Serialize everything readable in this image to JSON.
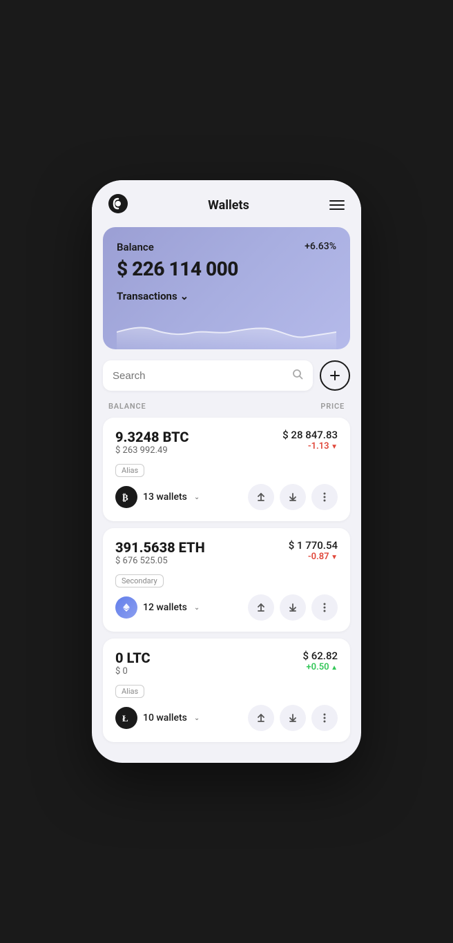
{
  "app": {
    "title": "Wallets"
  },
  "balance_card": {
    "label": "Balance",
    "amount": "$ 226 114 000",
    "change": "+6.63%",
    "transactions_label": "Transactions"
  },
  "search": {
    "placeholder": "Search"
  },
  "table_headers": {
    "balance": "BALANCE",
    "price": "PRICE"
  },
  "assets": [
    {
      "id": "btc",
      "amount": "9.3248 BTC",
      "usd_value": "$ 263 992.49",
      "price": "$ 28 847.83",
      "change": "-1.13",
      "change_type": "negative",
      "alias": "Alias",
      "wallets": "13 wallets",
      "icon": "₿"
    },
    {
      "id": "eth",
      "amount": "391.5638 ETH",
      "usd_value": "$ 676 525.05",
      "price": "$ 1 770.54",
      "change": "-0.87",
      "change_type": "negative",
      "alias": "Secondary",
      "wallets": "12 wallets",
      "icon": "Ξ"
    },
    {
      "id": "ltc",
      "amount": "0 LTC",
      "usd_value": "$ 0",
      "price": "$ 62.82",
      "change": "+0.50",
      "change_type": "positive",
      "alias": "Alias",
      "wallets": "10 wallets",
      "icon": "Ł"
    }
  ]
}
